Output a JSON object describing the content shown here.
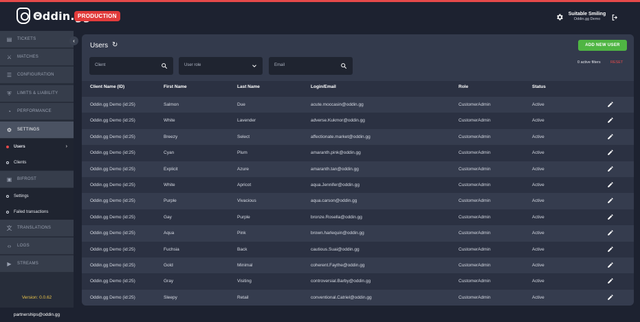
{
  "header": {
    "logo_text": "Θddin.gg",
    "env_badge": "PRODUCTION",
    "user_name": "Suitable Smiling",
    "user_org": "Oddin.gg Demo",
    "colors": {
      "accent": "#e64a4a",
      "badge": "#e23b3b",
      "add": "#4fb543"
    }
  },
  "sidebar": {
    "items": [
      {
        "label": "TICKETS",
        "icon": "ticket-icon"
      },
      {
        "label": "MATCHES",
        "icon": "matches-icon"
      },
      {
        "label": "CONFIGURATION",
        "icon": "sliders-icon"
      },
      {
        "label": "LIMITS & LIABILITY",
        "icon": "shield-icon"
      },
      {
        "label": "PERFORMANCE",
        "icon": "gauge-icon"
      },
      {
        "label": "SETTINGS",
        "icon": "gear-icon"
      }
    ],
    "settings_sub": [
      {
        "label": "Users"
      },
      {
        "label": "Clients"
      }
    ],
    "bifrost": {
      "label": "BIFROST",
      "icon": "bifrost-icon"
    },
    "bifrost_sub": [
      {
        "label": "Settings"
      },
      {
        "label": "Failed transactions"
      }
    ],
    "bottom_items": [
      {
        "label": "TRANSLATIONS",
        "icon": "translate-icon"
      },
      {
        "label": "LOGS",
        "icon": "code-icon"
      },
      {
        "label": "STREAMS",
        "icon": "stream-icon"
      }
    ],
    "version": "Version: 0.0.62",
    "contact": "partnerships@oddin.gg"
  },
  "main": {
    "title": "Users",
    "add_button": "ADD NEW USER",
    "filters": {
      "client_placeholder": "Client",
      "role_placeholder": "User role",
      "email_placeholder": "Email",
      "active_filters": "0 active filters",
      "reset": "RESET"
    },
    "columns": [
      "Client Name (ID)",
      "First Name",
      "Last Name",
      "Login/Email",
      "Role",
      "Status"
    ],
    "rows": [
      {
        "client": "Oddin.gg Demo (id:25)",
        "first": "Salmon",
        "last": "Due",
        "email": "acute.moccasin@oddin.gg",
        "role": "CustomerAdmin",
        "status": "Active"
      },
      {
        "client": "Oddin.gg Demo (id:25)",
        "first": "White",
        "last": "Lavender",
        "email": "adverse.Kukmor@oddin.gg",
        "role": "CustomerAdmin",
        "status": "Active"
      },
      {
        "client": "Oddin.gg Demo (id:25)",
        "first": "Breezy",
        "last": "Select",
        "email": "affectionate.market@oddin.gg",
        "role": "CustomerAdmin",
        "status": "Active"
      },
      {
        "client": "Oddin.gg Demo (id:25)",
        "first": "Cyan",
        "last": "Plum",
        "email": "amaranth.pink@oddin.gg",
        "role": "CustomerAdmin",
        "status": "Active"
      },
      {
        "client": "Oddin.gg Demo (id:25)",
        "first": "Explicit",
        "last": "Azure",
        "email": "amaranth.tan@oddin.gg",
        "role": "CustomerAdmin",
        "status": "Active"
      },
      {
        "client": "Oddin.gg Demo (id:25)",
        "first": "White",
        "last": "Apricot",
        "email": "aqua.Jennifer@oddin.gg",
        "role": "CustomerAdmin",
        "status": "Active"
      },
      {
        "client": "Oddin.gg Demo (id:25)",
        "first": "Purple",
        "last": "Vivacious",
        "email": "aqua.carson@oddin.gg",
        "role": "CustomerAdmin",
        "status": "Active"
      },
      {
        "client": "Oddin.gg Demo (id:25)",
        "first": "Gay",
        "last": "Purple",
        "email": "bronze.Rosella@oddin.gg",
        "role": "CustomerAdmin",
        "status": "Active"
      },
      {
        "client": "Oddin.gg Demo (id:25)",
        "first": "Aqua",
        "last": "Pink",
        "email": "brown.harlequin@oddin.gg",
        "role": "CustomerAdmin",
        "status": "Active"
      },
      {
        "client": "Oddin.gg Demo (id:25)",
        "first": "Fuchsia",
        "last": "Back",
        "email": "cautious.Suai@oddin.gg",
        "role": "CustomerAdmin",
        "status": "Active"
      },
      {
        "client": "Oddin.gg Demo (id:25)",
        "first": "Gold",
        "last": "Minimal",
        "email": "coherent.Faythe@oddin.gg",
        "role": "CustomerAdmin",
        "status": "Active"
      },
      {
        "client": "Oddin.gg Demo (id:25)",
        "first": "Gray",
        "last": "Visiting",
        "email": "controversial.Barby@oddin.gg",
        "role": "CustomerAdmin",
        "status": "Active"
      },
      {
        "client": "Oddin.gg Demo (id:25)",
        "first": "Sleepy",
        "last": "Retail",
        "email": "conventional.Catriel@oddin.gg",
        "role": "CustomerAdmin",
        "status": "Active"
      }
    ]
  }
}
